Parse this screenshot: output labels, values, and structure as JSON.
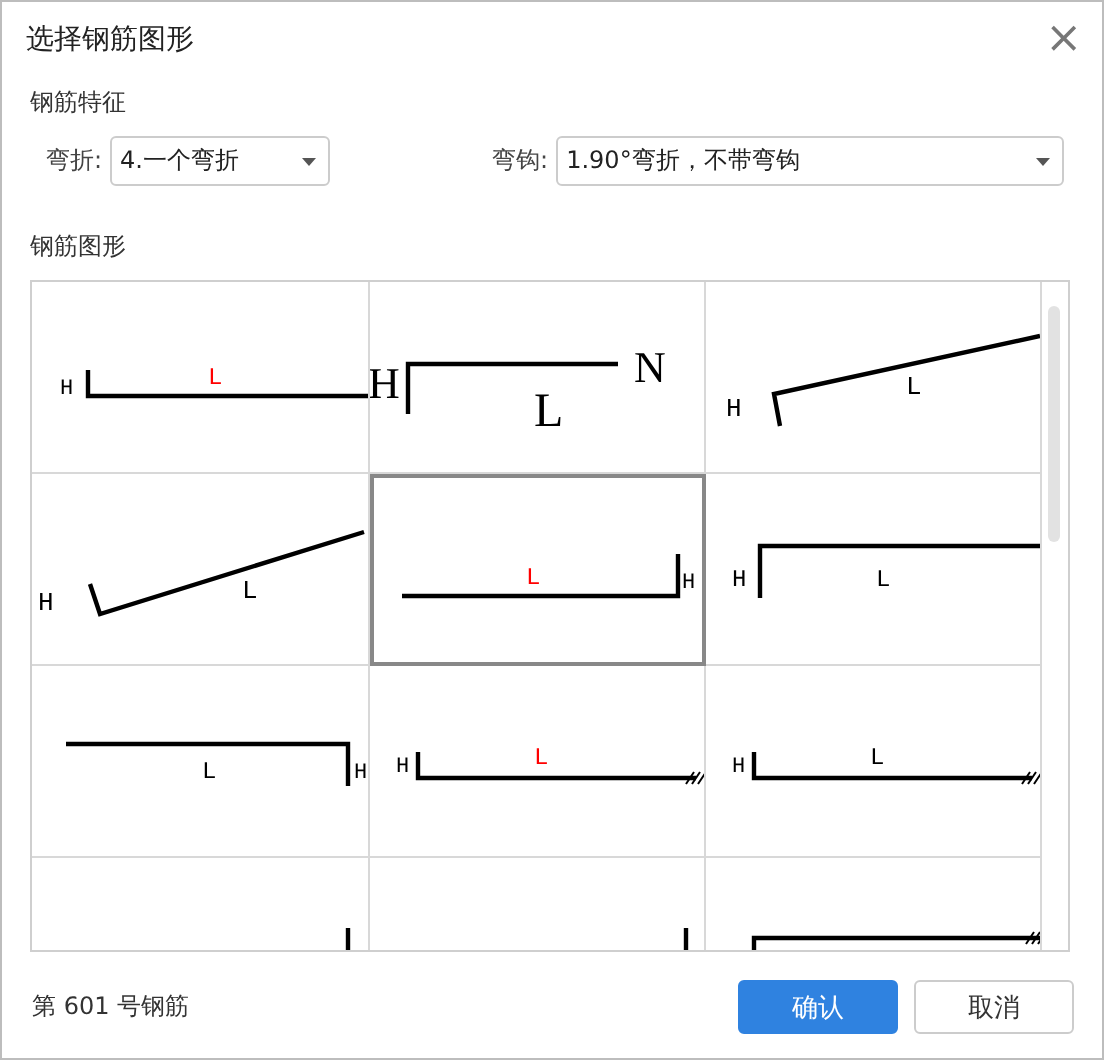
{
  "window": {
    "title": "选择钢筋图形",
    "close": "×"
  },
  "features": {
    "heading": "钢筋特征",
    "fields": [
      {
        "label": "弯折:",
        "value": "4.一个弯折",
        "kind": "short"
      },
      {
        "label": "弯钩:",
        "value": "1.90°弯折，不带弯钩",
        "kind": "wide"
      }
    ]
  },
  "shapes": {
    "heading": "钢筋图形",
    "cells": [
      {
        "kind": "hook-up-left",
        "selected": false,
        "labels": [
          {
            "text": "H",
            "color": "#000000"
          },
          {
            "text": "L",
            "color": "#ff0000"
          }
        ]
      },
      {
        "kind": "bend-n",
        "selected": false,
        "labels": [
          {
            "text": "H",
            "color": "#000000"
          },
          {
            "text": "L",
            "color": "#000000"
          },
          {
            "text": "N",
            "color": "#000000"
          }
        ]
      },
      {
        "kind": "slope-high",
        "selected": false,
        "labels": [
          {
            "text": "H",
            "color": "#000000"
          },
          {
            "text": "L",
            "color": "#000000"
          }
        ]
      },
      {
        "kind": "slope-low",
        "selected": false,
        "labels": [
          {
            "text": "H",
            "color": "#000000"
          },
          {
            "text": "L",
            "color": "#000000"
          }
        ]
      },
      {
        "kind": "end-up-right",
        "selected": true,
        "labels": [
          {
            "text": "L",
            "color": "#ff0000"
          },
          {
            "text": "H",
            "color": "#000000"
          }
        ]
      },
      {
        "kind": "start-down-left",
        "selected": false,
        "labels": [
          {
            "text": "H",
            "color": "#000000"
          },
          {
            "text": "L",
            "color": "#000000"
          }
        ]
      },
      {
        "kind": "end-down-right",
        "selected": false,
        "labels": [
          {
            "text": "L",
            "color": "#000000"
          },
          {
            "text": "H",
            "color": "#000000"
          }
        ]
      },
      {
        "kind": "hook-hatch",
        "selected": false,
        "labels": [
          {
            "text": "H",
            "color": "#000000"
          },
          {
            "text": "L",
            "color": "#ff0000"
          }
        ]
      },
      {
        "kind": "hook-hatch",
        "selected": false,
        "labels": [
          {
            "text": "H",
            "color": "#000000"
          },
          {
            "text": "L",
            "color": "#000000"
          }
        ]
      },
      {
        "kind": "end-up-right-low",
        "selected": false
      },
      {
        "kind": "end-up-right-low",
        "selected": false
      },
      {
        "kind": "start-down-hatch",
        "selected": false
      }
    ]
  },
  "footer": {
    "status": "第 601 号钢筋",
    "buttons": [
      {
        "label": "确认",
        "kind": "primary"
      },
      {
        "label": "取消",
        "kind": "secondary"
      }
    ]
  }
}
